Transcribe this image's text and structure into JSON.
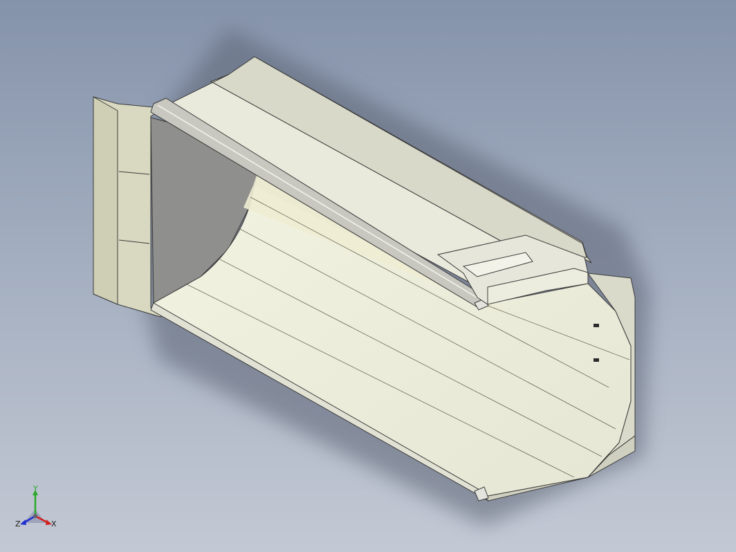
{
  "viewport": {
    "background_top": "#8593aa",
    "background_bottom": "#c3c9d4",
    "model_face_color": "#e8e8dc",
    "model_edge_color": "#3a3a3a"
  },
  "triad": {
    "y_label": "Y",
    "x_label": "X",
    "z_label": "Z",
    "y_color": "#2aa82a",
    "x_color": "#d02020",
    "z_color": "#2030d0"
  }
}
